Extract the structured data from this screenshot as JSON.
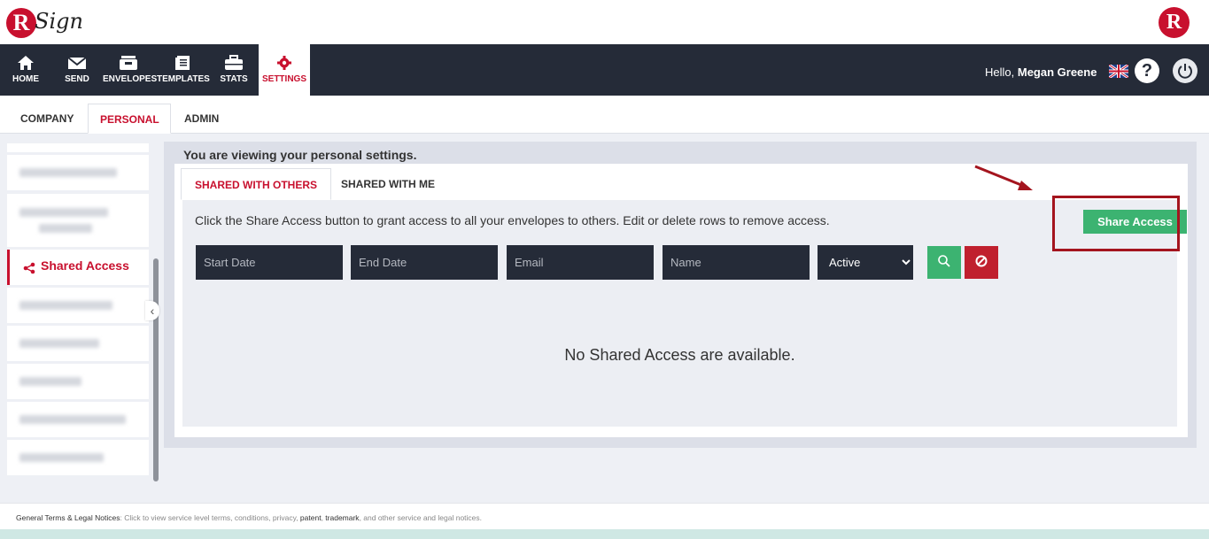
{
  "brand": {
    "logo_letter": "R",
    "logo_text": "Sign",
    "right_logo_letter": "R"
  },
  "nav": {
    "items": [
      {
        "label": "HOME",
        "icon": "home-icon"
      },
      {
        "label": "SEND",
        "icon": "envelope-icon"
      },
      {
        "label": "ENVELOPES",
        "icon": "inbox-icon"
      },
      {
        "label": "TEMPLATES",
        "icon": "document-icon"
      },
      {
        "label": "STATS",
        "icon": "briefcase-icon"
      },
      {
        "label": "SETTINGS",
        "icon": "gear-icon",
        "active": true
      }
    ],
    "greeting": "Hello, ",
    "user_name": "Megan Greene",
    "help_icon": "question-icon",
    "logout_icon": "power-icon"
  },
  "settings_tabs": [
    {
      "label": "COMPANY"
    },
    {
      "label": "PERSONAL",
      "active": true
    },
    {
      "label": "ADMIN"
    }
  ],
  "sidebar": {
    "active_item": {
      "label": "Shared Access",
      "icon": "share-icon"
    }
  },
  "panel": {
    "title": "You are viewing your personal settings.",
    "tabs": [
      {
        "label": "SHARED WITH OTHERS",
        "active": true
      },
      {
        "label": "SHARED WITH ME"
      }
    ],
    "info_text": "Click the Share Access button to grant access to all your envelopes to others. Edit or delete rows to remove access.",
    "share_button": "Share Access",
    "filters": {
      "start_date": "Start Date",
      "end_date": "End Date",
      "email": "Email",
      "name": "Name",
      "status_selected": "Active"
    },
    "empty_message": "No Shared Access are available."
  },
  "footer": {
    "lead": "General Terms & Legal Notices",
    "text_a": ": Click to view service level terms, conditions, privacy, ",
    "patent": "patent",
    "sep": ", ",
    "trademark": "trademark",
    "text_b": ", and other service and legal notices."
  },
  "colors": {
    "accent_red": "#c8102e",
    "nav_bg": "#252b38",
    "green": "#3cb371"
  }
}
